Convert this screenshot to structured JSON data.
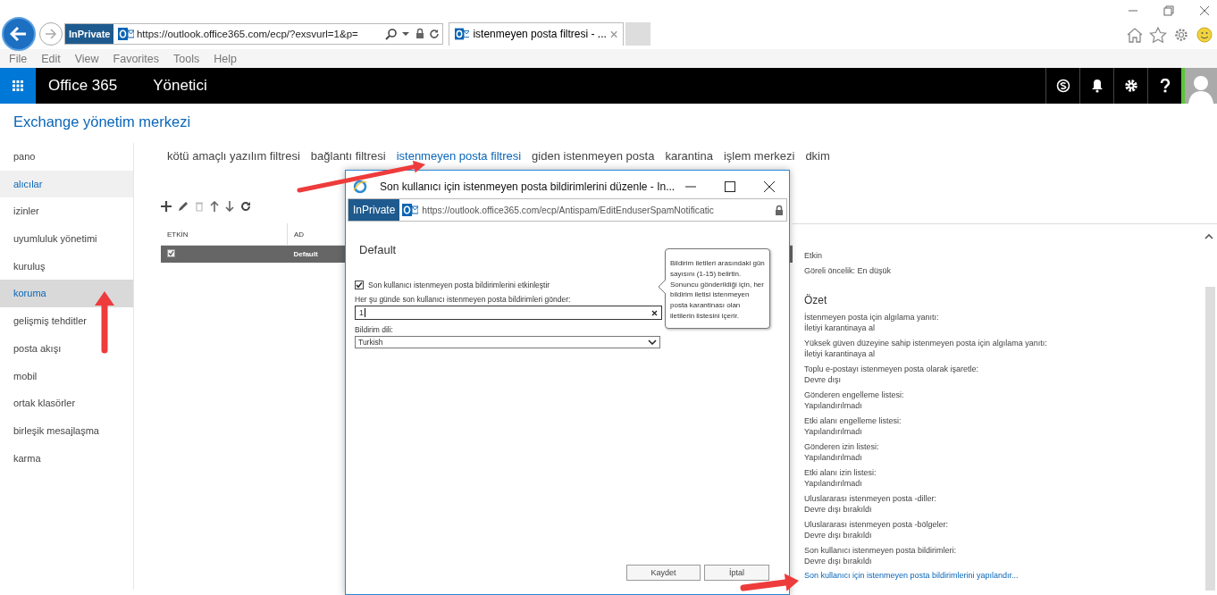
{
  "browser": {
    "inprivate": "InPrivate",
    "url": "https://outlook.office365.com/ecp/?exsvurl=1&p=",
    "tabs": [
      {
        "title": "istenmeyen posta filtresi - ...",
        "selected": true
      }
    ],
    "menu": [
      "File",
      "Edit",
      "View",
      "Favorites",
      "Tools",
      "Help"
    ]
  },
  "suite_bar": {
    "app": "Office 365",
    "section": "Yönetici"
  },
  "page_title": "Exchange yönetim merkezi",
  "nav": [
    {
      "label": "pano",
      "selected": false,
      "hovered": false
    },
    {
      "label": "alıcılar",
      "selected": false,
      "hovered": true
    },
    {
      "label": "izinler",
      "selected": false,
      "hovered": false
    },
    {
      "label": "uyumluluk yönetimi",
      "selected": false,
      "hovered": false
    },
    {
      "label": "kuruluş",
      "selected": false,
      "hovered": false
    },
    {
      "label": "koruma",
      "selected": true,
      "hovered": false
    },
    {
      "label": "gelişmiş tehditler",
      "selected": false,
      "hovered": false
    },
    {
      "label": "posta akışı",
      "selected": false,
      "hovered": false
    },
    {
      "label": "mobil",
      "selected": false,
      "hovered": false
    },
    {
      "label": "ortak klasörler",
      "selected": false,
      "hovered": false
    },
    {
      "label": "birleşik mesajlaşma",
      "selected": false,
      "hovered": false
    },
    {
      "label": "karma",
      "selected": false,
      "hovered": false
    }
  ],
  "tabs": [
    {
      "label": "kötü amaçlı yazılım filtresi",
      "selected": false
    },
    {
      "label": "bağlantı filtresi",
      "selected": false
    },
    {
      "label": "istenmeyen posta filtresi",
      "selected": true
    },
    {
      "label": "giden istenmeyen posta",
      "selected": false
    },
    {
      "label": "karantina",
      "selected": false
    },
    {
      "label": "işlem merkezi",
      "selected": false
    },
    {
      "label": "dkim",
      "selected": false
    }
  ],
  "table": {
    "columns": [
      "ETKİN",
      "AD"
    ],
    "rows": [
      {
        "enabled": true,
        "name": "Default",
        "selected": true
      }
    ]
  },
  "details": {
    "status": "Etkin",
    "priority": "Göreli öncelik: En düşük",
    "heading": "Özet",
    "items": [
      {
        "label": "İstenmeyen posta için algılama yanıtı:",
        "value": "İletiyi karantinaya al"
      },
      {
        "label": "Yüksek güven düzeyine sahip istenmeyen posta için algılama yanıtı:",
        "value": "İletiyi karantinaya al"
      },
      {
        "label": "Toplu e-postayı istenmeyen posta olarak işaretle:",
        "value": "Devre dışı"
      },
      {
        "label": "Gönderen engelleme listesi:",
        "value": "Yapılandırılmadı"
      },
      {
        "label": "Etki alanı engelleme listesi:",
        "value": "Yapılandırılmadı"
      },
      {
        "label": "Gönderen izin listesi:",
        "value": "Yapılandırılmadı"
      },
      {
        "label": "Etki alanı izin listesi:",
        "value": "Yapılandırılmadı"
      },
      {
        "label": "Uluslararası istenmeyen posta -diller:",
        "value": "Devre dışı bırakıldı"
      },
      {
        "label": "Uluslararası istenmeyen posta -bölgeler:",
        "value": "Devre dışı bırakıldı"
      },
      {
        "label": "Son kullanıcı istenmeyen posta bildirimleri:",
        "value": "Devre dışı bırakıldı"
      }
    ],
    "link": "Son kullanıcı için istenmeyen posta bildirimlerini yapılandır..."
  },
  "dialog": {
    "title": "Son kullanıcı için istenmeyen posta bildirimlerini düzenle - In...",
    "inprivate": "InPrivate",
    "url": "https://outlook.office365.com/ecp/Antispam/EditEnduserSpamNotificatic",
    "heading": "Default",
    "enable": {
      "label": "Son kullanıcı istenmeyen posta bildirimlerini etkinleştir",
      "checked": true
    },
    "frequency": {
      "label": "Her şu günde son kullanıcı istenmeyen posta bildirimleri gönder:",
      "value": "1"
    },
    "language": {
      "label": "Bildirim dili:",
      "value": "Turkish"
    },
    "tooltip": "Bildirim iletileri arasındaki gün sayısını (1-15) belirtin. Sonuncu gönderildiği için, her bildirim iletisi istenmeyen posta karantinası olan iletilerin listesini içerir.",
    "buttons": [
      {
        "label": "Kaydet",
        "kind": "save"
      },
      {
        "label": "İptal",
        "kind": "cancel"
      }
    ]
  }
}
